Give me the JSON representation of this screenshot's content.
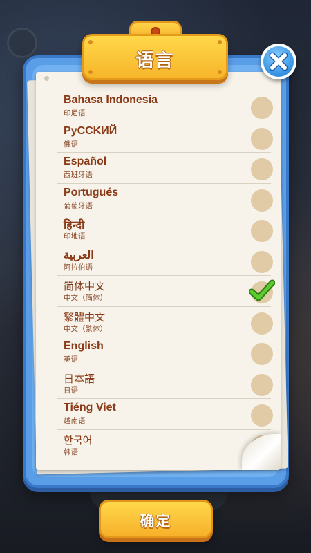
{
  "dialog": {
    "title": "语言",
    "confirm_label": "确定",
    "close_icon": "close-x-icon"
  },
  "languages": [
    {
      "name": "Bahasa Indonesia",
      "sub": "印尼语",
      "selected": false
    },
    {
      "name": "PyCCKИЙ",
      "sub": "俄语",
      "selected": false
    },
    {
      "name": "Español",
      "sub": "西班牙语",
      "selected": false
    },
    {
      "name": "Portugués",
      "sub": "葡萄牙语",
      "selected": false
    },
    {
      "name": "हिन्दी",
      "sub": "印地语",
      "selected": false
    },
    {
      "name": "العربية",
      "sub": "阿拉伯语",
      "selected": false
    },
    {
      "name": "简体中文",
      "sub": "中文（简体）",
      "selected": true
    },
    {
      "name": "繁體中文",
      "sub": "中文（繁体）",
      "selected": false
    },
    {
      "name": "English",
      "sub": "英语",
      "selected": false
    },
    {
      "name": "日本語",
      "sub": "日语",
      "selected": false
    },
    {
      "name": "Tiéng Viet",
      "sub": "越南语",
      "selected": false
    },
    {
      "name": "한국어",
      "sub": "韩语",
      "selected": false
    }
  ],
  "colors": {
    "panel_blue": "#5b9ee8",
    "tab_yellow": "#f7b52a",
    "text_brown": "#8a3a16",
    "radio_beige": "#e0cba6",
    "check_green": "#4caf2a"
  }
}
